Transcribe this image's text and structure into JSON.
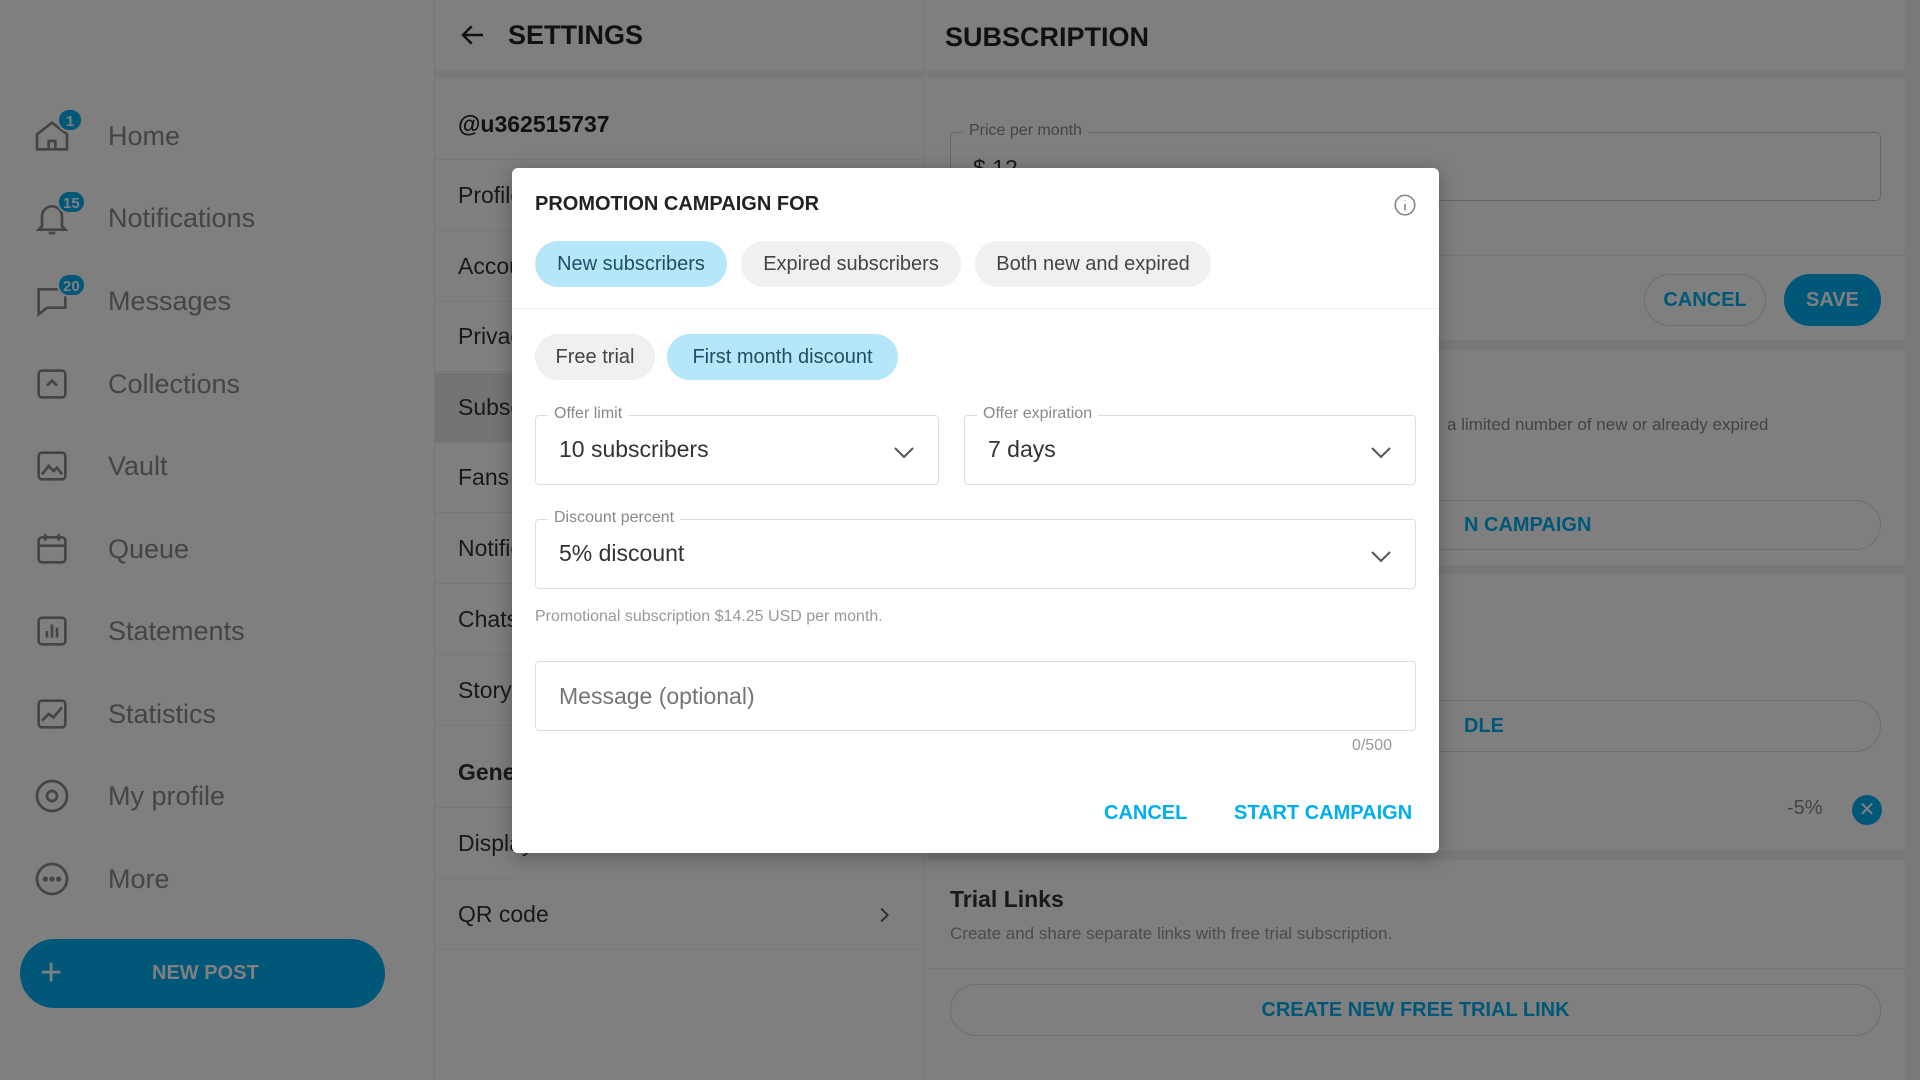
{
  "sidebar": {
    "items": [
      {
        "label": "Home",
        "icon": "home-icon",
        "badge": "1"
      },
      {
        "label": "Notifications",
        "icon": "bell-icon",
        "badge": "15"
      },
      {
        "label": "Messages",
        "icon": "message-icon",
        "badge": "20"
      },
      {
        "label": "Collections",
        "icon": "collections-icon",
        "badge": null
      },
      {
        "label": "Vault",
        "icon": "image-icon",
        "badge": null
      },
      {
        "label": "Queue",
        "icon": "calendar-icon",
        "badge": null
      },
      {
        "label": "Statements",
        "icon": "bar-chart-icon",
        "badge": null
      },
      {
        "label": "Statistics",
        "icon": "line-chart-icon",
        "badge": null
      },
      {
        "label": "My profile",
        "icon": "profile-icon",
        "badge": null
      },
      {
        "label": "More",
        "icon": "more-icon",
        "badge": null
      }
    ],
    "new_post": "NEW POST"
  },
  "settings": {
    "title": "SETTINGS",
    "username": "@u362515737",
    "items": [
      "Profile",
      "Account",
      "Privacy",
      "Subscription",
      "Fans",
      "Notifications",
      "Chats",
      "Story"
    ],
    "section": "General",
    "display": "Display",
    "qr": "QR code"
  },
  "subscription": {
    "title": "SUBSCRIPTION",
    "price_label": "Price per month",
    "price_value": "$ 12",
    "cancel": "CANCEL",
    "save": "SAVE",
    "promo_desc_fragment": "a limited number of new or already expired",
    "campaign_btn_fragment": "N CAMPAIGN",
    "bundle_btn_fragment": "DLE",
    "discount_tag": "-5%",
    "trial_title": "Trial Links",
    "trial_desc": "Create and share separate links with free trial subscription.",
    "trial_btn": "CREATE NEW FREE TRIAL LINK"
  },
  "modal": {
    "title": "PROMOTION CAMPAIGN FOR",
    "audience": [
      {
        "label": "New subscribers",
        "selected": true
      },
      {
        "label": "Expired subscribers",
        "selected": false
      },
      {
        "label": "Both new and expired",
        "selected": false
      }
    ],
    "type": [
      {
        "label": "Free trial",
        "selected": false
      },
      {
        "label": "First month discount",
        "selected": true
      }
    ],
    "offer_limit": {
      "label": "Offer limit",
      "value": "10 subscribers"
    },
    "offer_expiration": {
      "label": "Offer expiration",
      "value": "7 days"
    },
    "discount": {
      "label": "Discount percent",
      "value": "5% discount"
    },
    "helper": "Promotional subscription $14.25 USD per month.",
    "message_placeholder": "Message (optional)",
    "counter": "0/500",
    "cancel": "CANCEL",
    "start": "START CAMPAIGN"
  },
  "colors": {
    "accent": "#00aff0",
    "chip_selected": "#b5e6fa"
  }
}
